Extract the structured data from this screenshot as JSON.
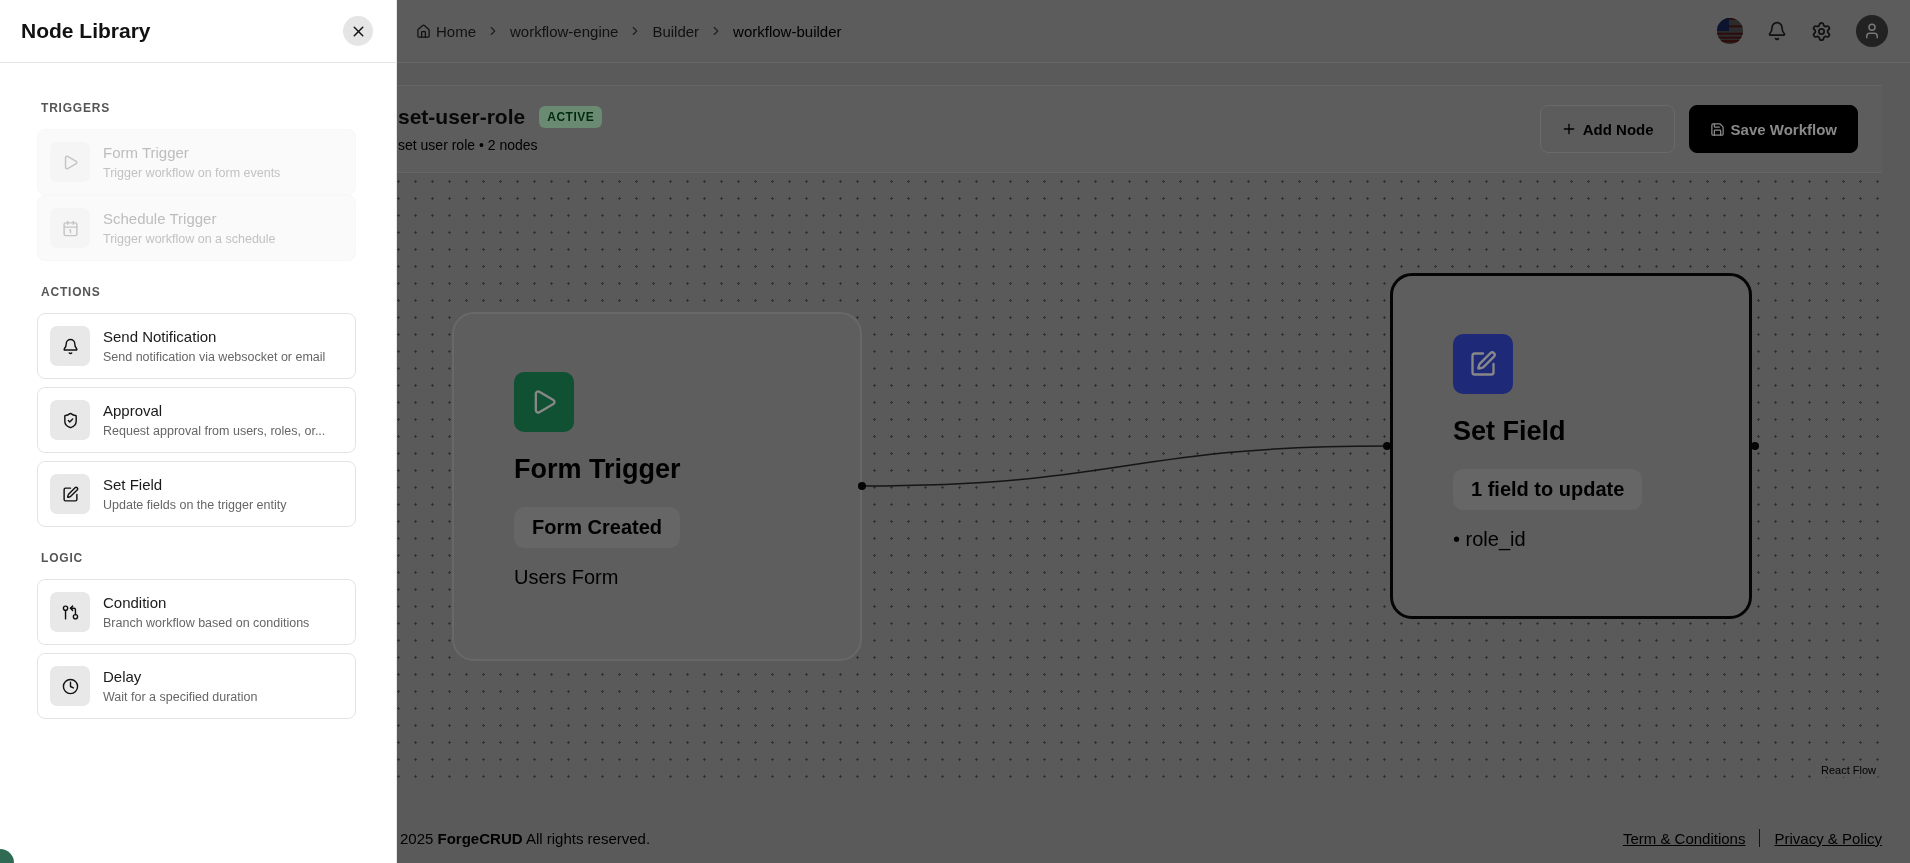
{
  "breadcrumb": [
    {
      "label": "Home",
      "current": false
    },
    {
      "label": "workflow-engine",
      "current": false
    },
    {
      "label": "Builder",
      "current": false
    },
    {
      "label": "workflow-builder",
      "current": true
    }
  ],
  "workflow": {
    "name": "set-user-role",
    "status": "ACTIVE",
    "subtitle": "set user role • 2 nodes"
  },
  "actions": [
    "Add Node",
    "Save Workflow"
  ],
  "nodes": [
    {
      "title": "Form Trigger",
      "badge": "Form Created",
      "detail": "Users Form",
      "selected": false,
      "color": "#0f5132"
    },
    {
      "title": "Set Field",
      "badge": "1 field to update",
      "detail": "• role_id",
      "selected": true,
      "color": "#1e2a78"
    }
  ],
  "attribution": "React Flow",
  "footer": {
    "copyright": "2025 **ForgeCRUD** All rights reserved.",
    "links": [
      "Term & Conditions",
      "Privacy & Policy"
    ]
  },
  "drawer": {
    "title": "Node Library",
    "sections": [
      {
        "label": "TRIGGERS",
        "items": [
          {
            "name": "Form Trigger",
            "description": "Trigger workflow on form events",
            "disabled": true
          },
          {
            "name": "Schedule Trigger",
            "description": "Trigger workflow on a schedule",
            "disabled": true
          }
        ]
      },
      {
        "label": "ACTIONS",
        "items": [
          {
            "name": "Send Notification",
            "description": "Send notification via websocket or email",
            "disabled": false
          },
          {
            "name": "Approval",
            "description": "Request approval from users, roles, or...",
            "disabled": false
          },
          {
            "name": "Set Field",
            "description": "Update fields on the trigger entity",
            "disabled": false
          }
        ]
      },
      {
        "label": "LOGIC",
        "items": [
          {
            "name": "Condition",
            "description": "Branch workflow based on conditions",
            "disabled": false
          },
          {
            "name": "Delay",
            "description": "Wait for a specified duration",
            "disabled": false
          }
        ]
      }
    ]
  }
}
